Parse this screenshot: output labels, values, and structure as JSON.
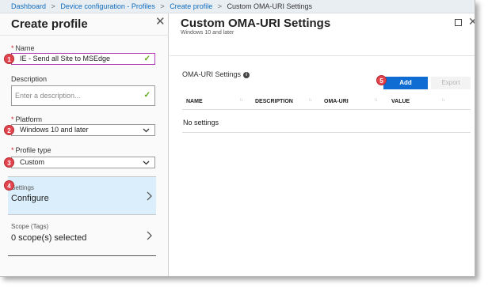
{
  "breadcrumb": {
    "items": [
      "Dashboard",
      "Device configuration - Profiles",
      "Create profile"
    ],
    "current": "Custom OMA-URI Settings"
  },
  "left_panel": {
    "title": "Create profile",
    "name": {
      "label": "Name",
      "value": "IE - Send all Site to MSEdge",
      "step": "1"
    },
    "description": {
      "label": "Description",
      "placeholder": "Enter a description..."
    },
    "platform": {
      "label": "Platform",
      "value": "Windows 10 and later",
      "step": "2"
    },
    "profile_type": {
      "label": "Profile type",
      "value": "Custom",
      "step": "3"
    },
    "settings": {
      "label": "Settings",
      "value": "Configure",
      "step": "4"
    },
    "scope": {
      "label": "Scope (Tags)",
      "value": "0 scope(s) selected"
    }
  },
  "right_panel": {
    "title": "Custom OMA-URI Settings",
    "subtitle": "Windows 10 and later",
    "section_label": "OMA-URI Settings",
    "add_button": "Add",
    "add_step": "5",
    "export_button": "Export",
    "columns": [
      "NAME",
      "DESCRIPTION",
      "OMA-URI",
      "VALUE"
    ],
    "empty_text": "No settings"
  },
  "colors": {
    "accent_blue": "#0f6cd3",
    "step_red": "#e2454e",
    "selected_bg": "#dbeefc",
    "check_green": "#5aa70e"
  }
}
